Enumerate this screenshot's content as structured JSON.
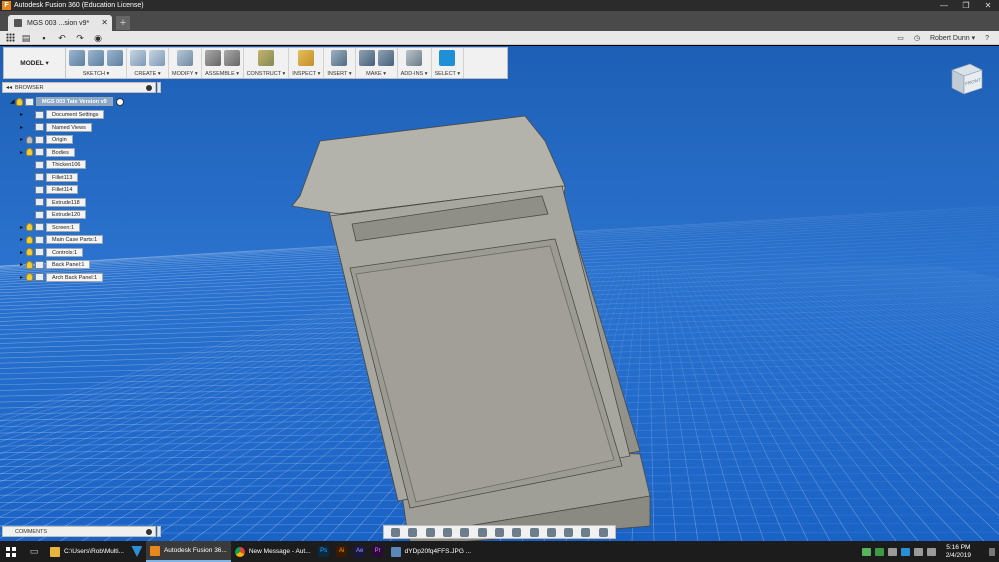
{
  "window": {
    "title": "Autodesk Fusion 360 (Education License)",
    "controls": [
      "—",
      "❐",
      "✕"
    ]
  },
  "doc_tab": {
    "title": "MGS 003 ...sion v9*",
    "close": "✕",
    "new_tab": "+"
  },
  "qat": {
    "user": "Robert Dunn ▾",
    "undo": "↶",
    "redo": "↷"
  },
  "ribbon": {
    "workspace": "MODEL ▾",
    "groups": [
      {
        "label": "SKETCH ▾"
      },
      {
        "label": "CREATE ▾"
      },
      {
        "label": "MODIFY ▾"
      },
      {
        "label": "ASSEMBLE ▾"
      },
      {
        "label": "CONSTRUCT ▾"
      },
      {
        "label": "INSPECT ▾"
      },
      {
        "label": "INSERT ▾"
      },
      {
        "label": "MAKE ▾"
      },
      {
        "label": "ADD-INS ▾"
      },
      {
        "label": "SELECT ▾"
      }
    ]
  },
  "browser": {
    "header": "BROWSER",
    "root": "MGS 003 Tate Version v9",
    "items": [
      {
        "label": "Document Settings"
      },
      {
        "label": "Named Views"
      },
      {
        "label": "Origin"
      },
      {
        "label": "Bodies"
      },
      {
        "label": "Thicken106"
      },
      {
        "label": "Fillet113"
      },
      {
        "label": "Fillet114"
      },
      {
        "label": "Extrude118"
      },
      {
        "label": "Extrude120"
      },
      {
        "label": "Screen:1"
      },
      {
        "label": "Main Case Parts:1"
      },
      {
        "label": "Controls:1"
      },
      {
        "label": "Back Panel:1"
      },
      {
        "label": "Arch Back Panel:1"
      }
    ]
  },
  "viewcube": {
    "label": "FRONT"
  },
  "comments": {
    "label": "COMMENTS"
  },
  "taskbar": {
    "items": [
      {
        "label": "C:\\Users\\Rob\\Multi..."
      },
      {
        "label": "Autodesk Fusion 36..."
      },
      {
        "label": "New Message - Aut..."
      },
      {
        "label": "dYDp20fq4FFS.JPG ..."
      }
    ],
    "apps": [
      "Ps",
      "Ai",
      "Ae",
      "Pr"
    ],
    "clock_time": "5:16 PM",
    "clock_date": "2/4/2019"
  },
  "colors": {
    "viewport": "#1d5fb5",
    "model": "#9a9a92",
    "accent": "#1f8fd6"
  }
}
